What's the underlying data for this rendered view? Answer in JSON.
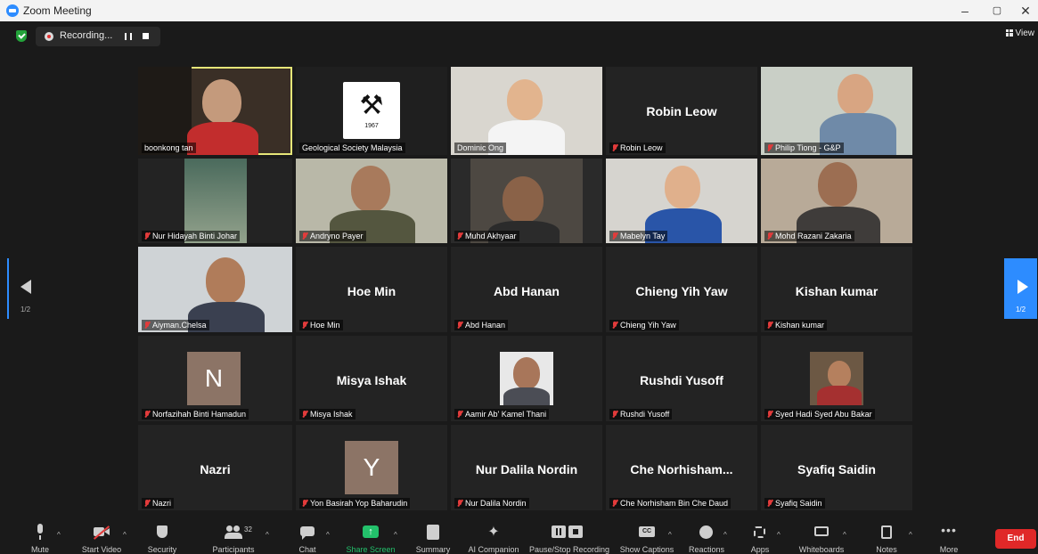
{
  "window": {
    "title": "Zoom Meeting",
    "minimize": "–",
    "restore": "▢",
    "close": "✕"
  },
  "topbar": {
    "recording_label": "Recording...",
    "view_label": "View"
  },
  "nav": {
    "page_left": "1/2",
    "page_right": "1/2"
  },
  "tiles": [
    {
      "label": "boonkong tan",
      "big": "",
      "kind": "video",
      "muted": false,
      "active": true
    },
    {
      "label": "Geological Society Malaysia",
      "big": "",
      "kind": "logo",
      "muted": false
    },
    {
      "label": "Dominic Ong",
      "big": "",
      "kind": "video",
      "muted": false
    },
    {
      "label": "Robin Leow",
      "big": "Robin Leow",
      "kind": "name",
      "muted": true
    },
    {
      "label": "Philip Tiong - G&P",
      "big": "",
      "kind": "video",
      "muted": true
    },
    {
      "label": "Nur Hidayah Binti Johar",
      "big": "",
      "kind": "video",
      "muted": true
    },
    {
      "label": "Andryno Payer",
      "big": "",
      "kind": "video",
      "muted": true
    },
    {
      "label": "Muhd Akhyaar",
      "big": "",
      "kind": "video",
      "muted": true
    },
    {
      "label": "Mabelyn Tay",
      "big": "",
      "kind": "video",
      "muted": true
    },
    {
      "label": "Mohd Razani Zakaria",
      "big": "",
      "kind": "video",
      "muted": true
    },
    {
      "label": "Aiyman.Chelsa",
      "big": "",
      "kind": "video",
      "muted": true
    },
    {
      "label": "Hoe Min",
      "big": "Hoe Min",
      "kind": "name",
      "muted": true
    },
    {
      "label": "Abd Hanan",
      "big": "Abd Hanan",
      "kind": "name",
      "muted": true
    },
    {
      "label": "Chieng Yih Yaw",
      "big": "Chieng Yih Yaw",
      "kind": "name",
      "muted": true
    },
    {
      "label": "Kishan kumar",
      "big": "Kishan kumar",
      "kind": "name",
      "muted": true
    },
    {
      "label": "Norfazihah Binti Hamadun",
      "big": "N",
      "kind": "avatar",
      "muted": true
    },
    {
      "label": "Misya Ishak",
      "big": "Misya Ishak",
      "kind": "name",
      "muted": true
    },
    {
      "label": "Aamir Ab' Kamel Thani",
      "big": "",
      "kind": "photo",
      "muted": true
    },
    {
      "label": "Rushdi Yusoff",
      "big": "Rushdi Yusoff",
      "kind": "name",
      "muted": true
    },
    {
      "label": "Syed Hadi Syed Abu Bakar",
      "big": "",
      "kind": "photo",
      "muted": true
    },
    {
      "label": "Nazri",
      "big": "Nazri",
      "kind": "name",
      "muted": true
    },
    {
      "label": "Yon Basirah Yop Baharudin",
      "big": "Y",
      "kind": "avatar",
      "muted": true
    },
    {
      "label": "Nur Dalila Nordin",
      "big": "Nur Dalila Nordin",
      "kind": "name",
      "muted": true
    },
    {
      "label": "Che Norhisham Bin Che Daud",
      "big": "Che  Norhisham...",
      "kind": "name",
      "muted": true
    },
    {
      "label": "Syafiq Saidin",
      "big": "Syafiq Saidin",
      "kind": "name",
      "muted": true
    }
  ],
  "logo_year": "1967",
  "toolbar": {
    "mute": "Mute",
    "start_video": "Start Video",
    "security": "Security",
    "participants": "Participants",
    "participants_count": "32",
    "chat": "Chat",
    "share_screen": "Share Screen",
    "summary": "Summary",
    "ai_companion": "AI Companion",
    "pause_stop": "Pause/Stop Recording",
    "show_captions": "Show Captions",
    "reactions": "Reactions",
    "apps": "Apps",
    "whiteboards": "Whiteboards",
    "notes": "Notes",
    "more": "More",
    "end": "End"
  },
  "colors": {
    "accent": "#2d8cff",
    "share_green": "#23c16b",
    "end_red": "#e02828",
    "active_outline": "#e6e678",
    "mute_red": "#e23b3b"
  }
}
